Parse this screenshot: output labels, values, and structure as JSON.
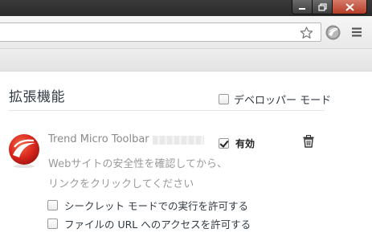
{
  "window": {
    "minimize_icon": "minimize-icon",
    "maximize_icon": "restore-icon",
    "close_icon": "close-icon"
  },
  "toolbar": {
    "address_value": "",
    "bookmark_icon": "star-icon",
    "extension_icon": "trend-micro-icon",
    "menu_icon": "hamburger-menu-icon"
  },
  "page": {
    "title": "拡張機能",
    "developer_mode_label": "デベロッパー モード",
    "developer_mode_checked": false
  },
  "extension": {
    "name": "Trend Micro Toolbar",
    "enabled_label": "有効",
    "enabled": true,
    "description_line1": "Webサイトの安全性を確認してから、",
    "description_line2": "リンクをクリックしてください",
    "incognito_label": "シークレット モードでの実行を許可する",
    "incognito_checked": false,
    "file_url_label": "ファイルの URL へのアクセスを許可する",
    "file_url_checked": false,
    "logo_color": "#d9261c"
  }
}
